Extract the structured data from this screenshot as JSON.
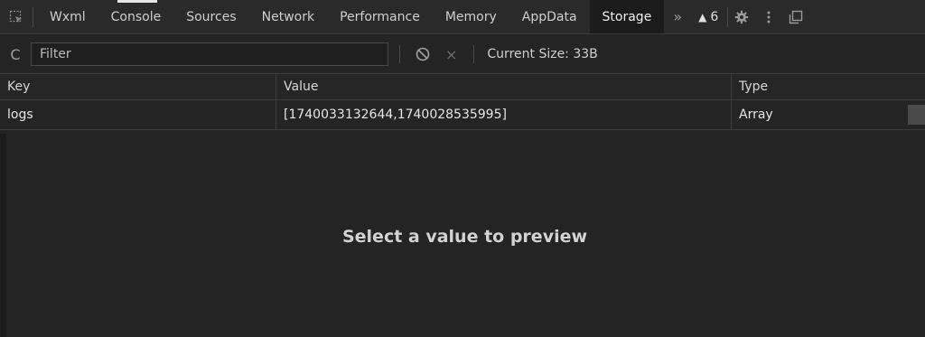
{
  "tabs": [
    {
      "label": "Wxml"
    },
    {
      "label": "Console"
    },
    {
      "label": "Sources"
    },
    {
      "label": "Network"
    },
    {
      "label": "Performance"
    },
    {
      "label": "Memory"
    },
    {
      "label": "AppData"
    },
    {
      "label": "Storage",
      "active": true
    }
  ],
  "tabbar": {
    "overflow": "»",
    "warning_count": "6",
    "icons": [
      "inspect-icon",
      "settings-icon",
      "more-icon",
      "dock-icon"
    ]
  },
  "toolbar": {
    "refresh_icon": "C",
    "filter_placeholder": "Filter",
    "clear_icon": "no-entry-icon",
    "delete_icon": "×",
    "current_size": "Current Size: 33B"
  },
  "table": {
    "columns": [
      "Key",
      "Value",
      "Type"
    ],
    "rows": [
      {
        "key": "logs",
        "value": "[1740033132644,1740028535995]",
        "type": "Array"
      }
    ]
  },
  "preview": {
    "message": "Select a value to preview"
  },
  "colors": {
    "background": "#242424",
    "tabbar": "#2a2a2a",
    "active_tab": "#1b1b1b",
    "text": "#d6d6d6"
  }
}
